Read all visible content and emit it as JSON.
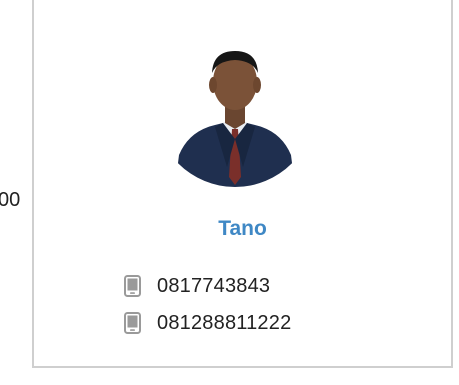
{
  "left_fragment": "00",
  "contact_card": {
    "name": "Tano",
    "phones": [
      "0817743843",
      "081288811222"
    ],
    "icons": {
      "avatar": "person-photo",
      "phone": "mobile-phone-icon"
    },
    "colors": {
      "name": "#3f88c5",
      "text": "#222222",
      "icon": "#9a9a9a",
      "border": "#cfcfcf"
    }
  }
}
